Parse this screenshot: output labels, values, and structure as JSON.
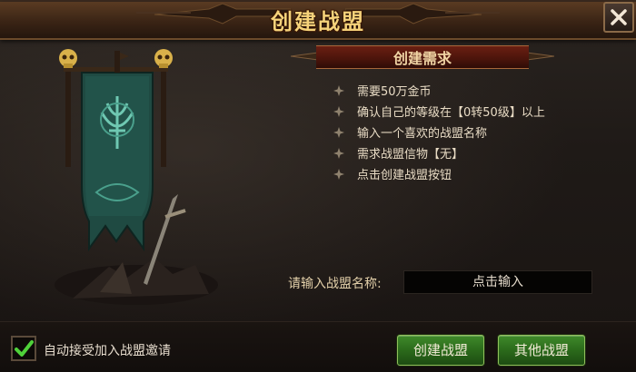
{
  "window": {
    "title": "创建战盟"
  },
  "requirements": {
    "header": "创建需求",
    "items": [
      "需要50万金币",
      "确认自己的等级在【0转50级】以上",
      "输入一个喜欢的战盟名称",
      "需求战盟信物【无】",
      "点击创建战盟按钮"
    ]
  },
  "name_input": {
    "label": "请输入战盟名称:",
    "placeholder": "点击输入"
  },
  "footer": {
    "auto_accept_label": "自动接受加入战盟邀请",
    "auto_accept_checked": true,
    "create_button": "创建战盟",
    "other_button": "其他战盟"
  },
  "icons": {
    "close": "close-icon",
    "checkmark": "checkmark-icon",
    "bullet": "diamond-bullet-icon",
    "banner": "guild-banner-image",
    "skull": "skull-icon"
  },
  "colors": {
    "title": "#f6d27a",
    "header_bar": "#5a1a0e",
    "button_green": "#2f7520",
    "check_green": "#4fd13a"
  }
}
